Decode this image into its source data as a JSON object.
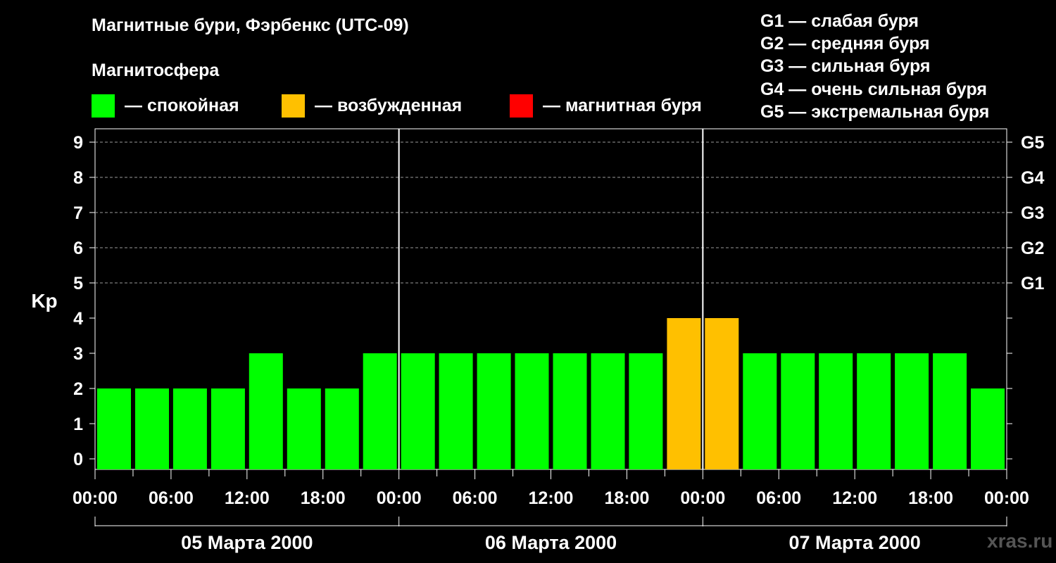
{
  "header": {
    "title": "Магнитные бури, Фэрбенкс (UTC-09)",
    "subtitle": "Магнитосфера"
  },
  "legend": [
    {
      "color": "#00ff00",
      "label": "— спокойная"
    },
    {
      "color": "#ffc000",
      "label": "— возбужденная"
    },
    {
      "color": "#ff0000",
      "label": "— магнитная буря"
    }
  ],
  "g_scale": [
    "G1 — слабая буря",
    "G2 — средняя буря",
    "G3 — сильная буря",
    "G4 — очень сильная буря",
    "G5 — экстремальная буря"
  ],
  "watermark": "xras.ru",
  "chart_data": {
    "type": "bar",
    "ylabel": "Kp",
    "ylim": [
      0,
      9
    ],
    "y_ticks": [
      "0",
      "1",
      "2",
      "3",
      "4",
      "5",
      "6",
      "7",
      "8",
      "9"
    ],
    "right_axis_labels": [
      {
        "level": 5,
        "label": "G1"
      },
      {
        "level": 6,
        "label": "G2"
      },
      {
        "level": 7,
        "label": "G3"
      },
      {
        "level": 8,
        "label": "G4"
      },
      {
        "level": 9,
        "label": "G5"
      }
    ],
    "x_tick_labels": [
      "00:00",
      "06:00",
      "12:00",
      "18:00",
      "00:00",
      "06:00",
      "12:00",
      "18:00",
      "00:00",
      "06:00",
      "12:00",
      "18:00",
      "00:00"
    ],
    "dates": [
      "05 Марта 2000",
      "06 Марта 2000",
      "07 Марта 2000"
    ],
    "values": [
      2,
      2,
      2,
      2,
      3,
      2,
      2,
      3,
      3,
      3,
      3,
      3,
      3,
      3,
      3,
      4,
      4,
      3,
      3,
      3,
      3,
      3,
      3,
      2
    ],
    "colors": {
      "quiet": "#00ff00",
      "disturbed": "#ffc000",
      "storm": "#ff0000"
    },
    "grid": "dashed horizontal at 5–9"
  }
}
